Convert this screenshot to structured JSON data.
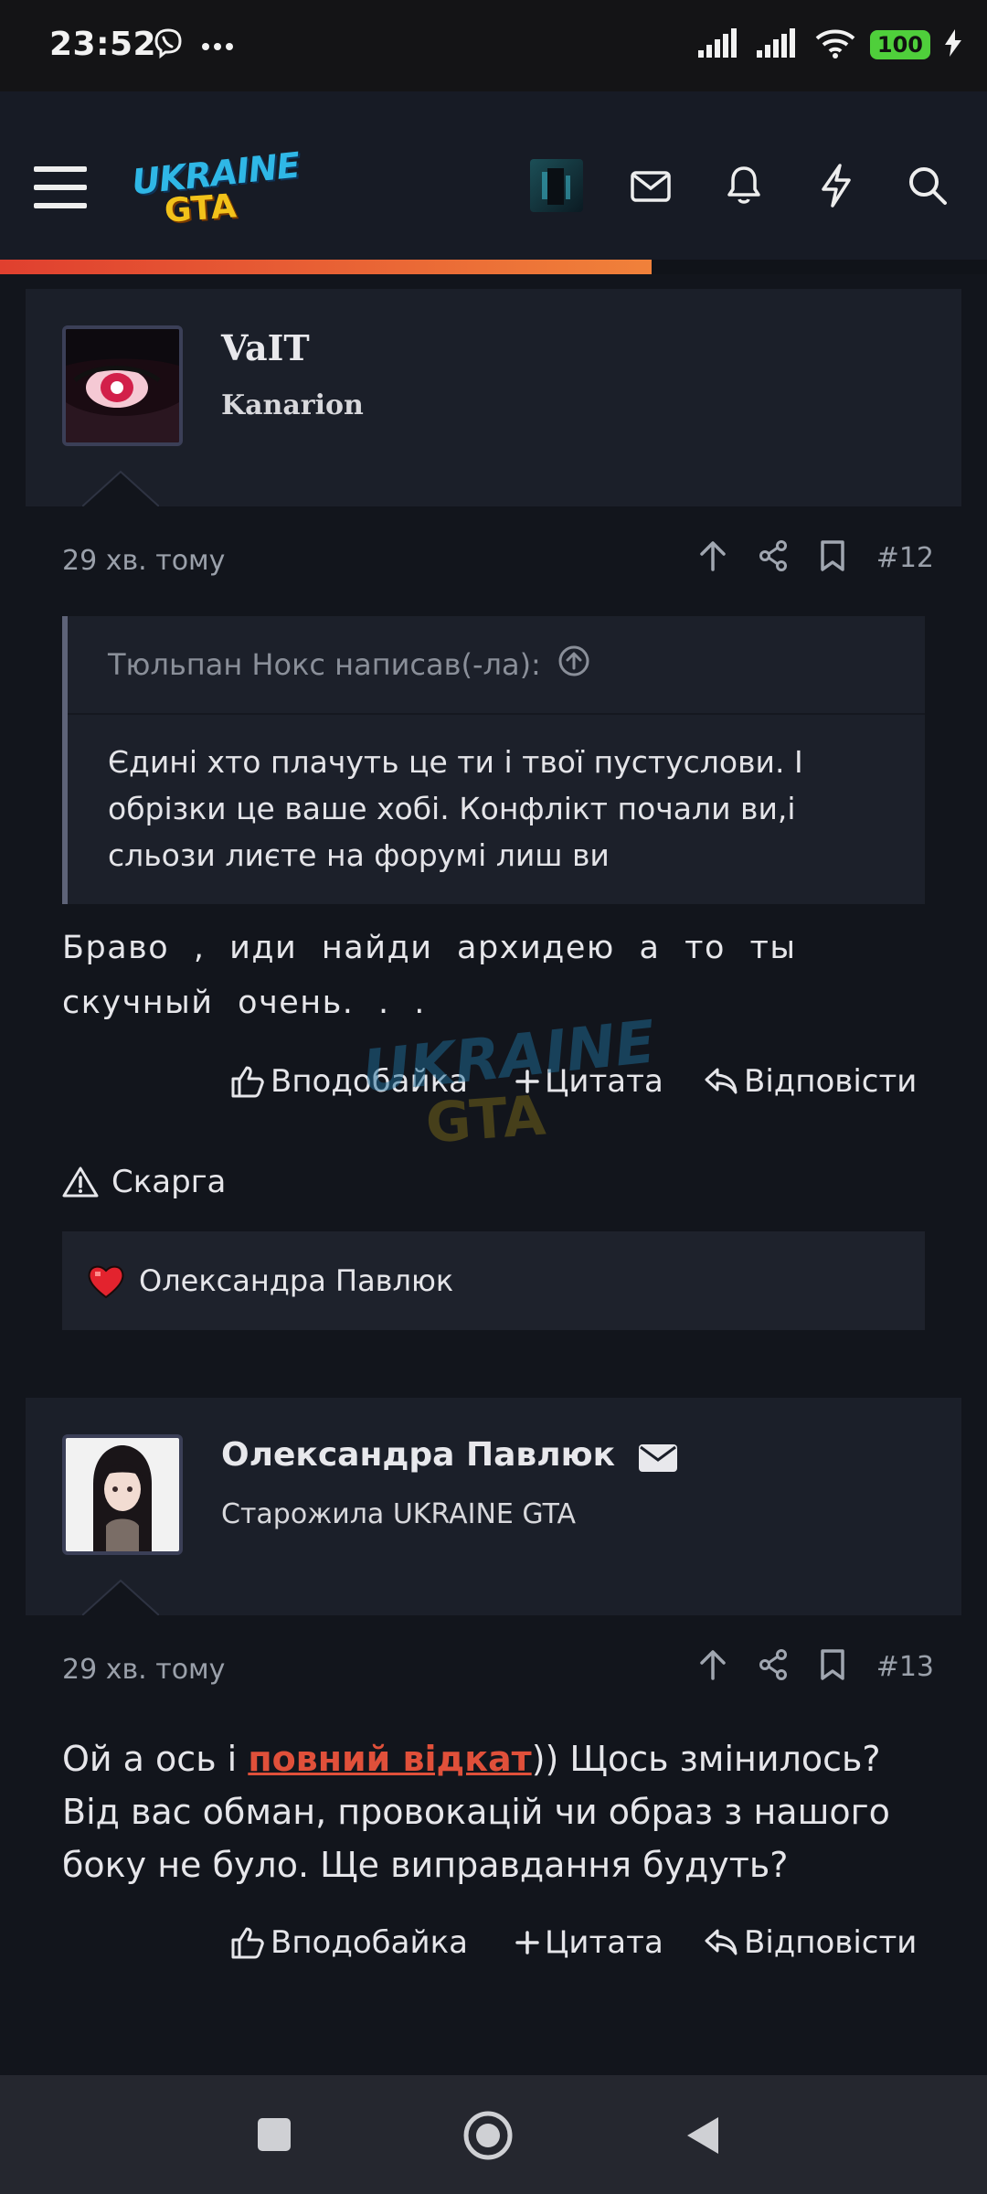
{
  "status_bar": {
    "time": "23:52",
    "battery": "100"
  },
  "header": {
    "logo_line1": "UKRAINE",
    "logo_line2": "GTA",
    "progress_percent": 66
  },
  "posts": [
    {
      "author": "VaIT",
      "author_title": "Kanarion",
      "time": "29 хв. тому",
      "number": "#12",
      "quote": {
        "author": "Тюльпан Нокс написав(-ла):",
        "text": "Єдині хто плачуть це ти і твої пустуслови. І обрізки це ваше хобі. Конфлікт почали ви,і сльози лиєте на форумі лиш ви"
      },
      "message": "Браво , иди найди архидею а то ты скучный очень. . .",
      "actions": {
        "like": "Вподобайка",
        "quote": "Цитата",
        "reply": "Відповісти"
      },
      "report": "Скарга",
      "liked_by": "Олександра Павлюк"
    },
    {
      "author": "Олександра Павлюк",
      "author_title": "Старожила UKRAINE GTA",
      "time": "29 хв. тому",
      "number": "#13",
      "message_before": "Ой а ось і ",
      "message_link": "повний відкат",
      "message_after": ")) Щось змінилось? Від вас обман, провокацій чи образ з нашого боку не було. Ще виправдання будуть?",
      "actions": {
        "like": "Вподобайка",
        "quote": "Цитата",
        "reply": "Відповісти"
      }
    }
  ],
  "watermark": {
    "line1": "UKRAINE",
    "line2": "GTA"
  },
  "colors": {
    "accent": "#e0503a",
    "progress_start": "#e0402f",
    "progress_end": "#f0813a",
    "bg": "#12151c"
  }
}
